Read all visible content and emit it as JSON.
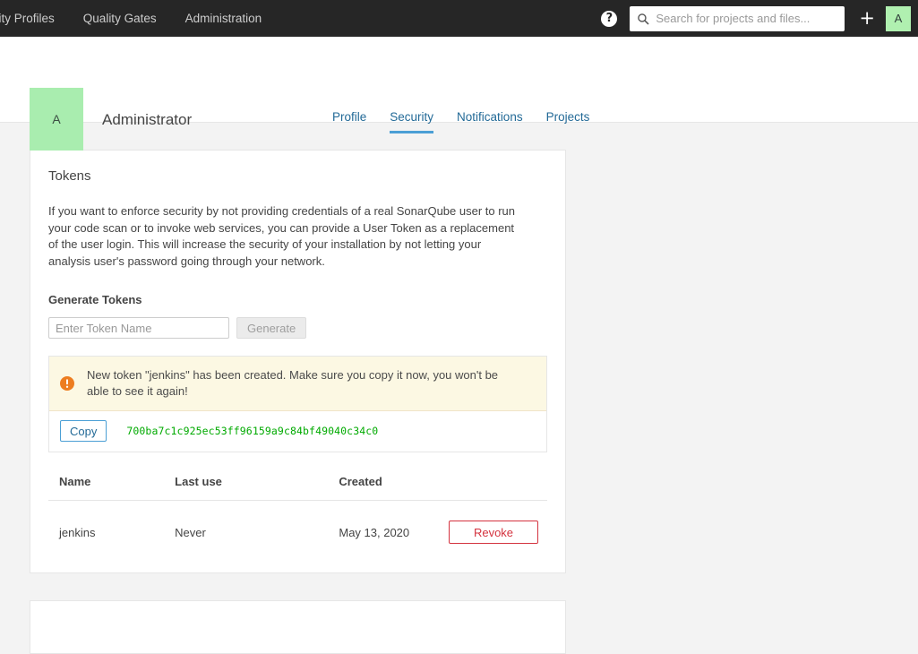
{
  "navbar": {
    "links": [
      {
        "label": "Quality Profiles",
        "name": "nav-link-quality-profiles"
      },
      {
        "label": "Quality Gates",
        "name": "nav-link-quality-gates"
      },
      {
        "label": "Administration",
        "name": "nav-link-administration"
      }
    ],
    "help_icon": "help-circle-icon",
    "search": {
      "placeholder": "Search for projects and files...",
      "value": "",
      "icon": "search-icon"
    },
    "plus_label": "+",
    "avatar_initial": "A"
  },
  "profile": {
    "avatar_initial": "A",
    "name": "Administrator",
    "tabs": [
      {
        "label": "Profile",
        "active": false
      },
      {
        "label": "Security",
        "active": true
      },
      {
        "label": "Notifications",
        "active": false
      },
      {
        "label": "Projects",
        "active": false
      }
    ]
  },
  "tokens_card": {
    "title": "Tokens",
    "description": "If you want to enforce security by not providing credentials of a real SonarQube user to run your code scan or to invoke web services, you can provide a User Token as a replacement of the user login. This will increase the security of your installation by not letting your analysis user's password going through your network.",
    "generate_section_title": "Generate Tokens",
    "token_name_placeholder": "Enter Token Name",
    "token_name_value": "",
    "generate_button_label": "Generate",
    "alert": {
      "icon": "warning-icon",
      "message": "New token \"jenkins\" has been created. Make sure you copy it now, you won't be able to see it again!",
      "copy_button_label": "Copy",
      "token_value": "700ba7c1c925ec53ff96159a9c84bf49040c34c0"
    },
    "table": {
      "columns": [
        "Name",
        "Last use",
        "Created",
        ""
      ],
      "rows": [
        {
          "name": "jenkins",
          "last_use": "Never",
          "created": "May 13, 2020",
          "action_label": "Revoke"
        }
      ]
    }
  },
  "colors": {
    "navbar_bg": "#262626",
    "accent_blue": "#4b9fd5",
    "link_blue": "#236a97",
    "avatar_green": "#a9edaf",
    "alert_bg": "#fcf8e3",
    "warning_orange": "#ed7d20",
    "token_green": "#00aa00",
    "danger_red": "#d4333f",
    "page_bg": "#f3f3f3"
  }
}
